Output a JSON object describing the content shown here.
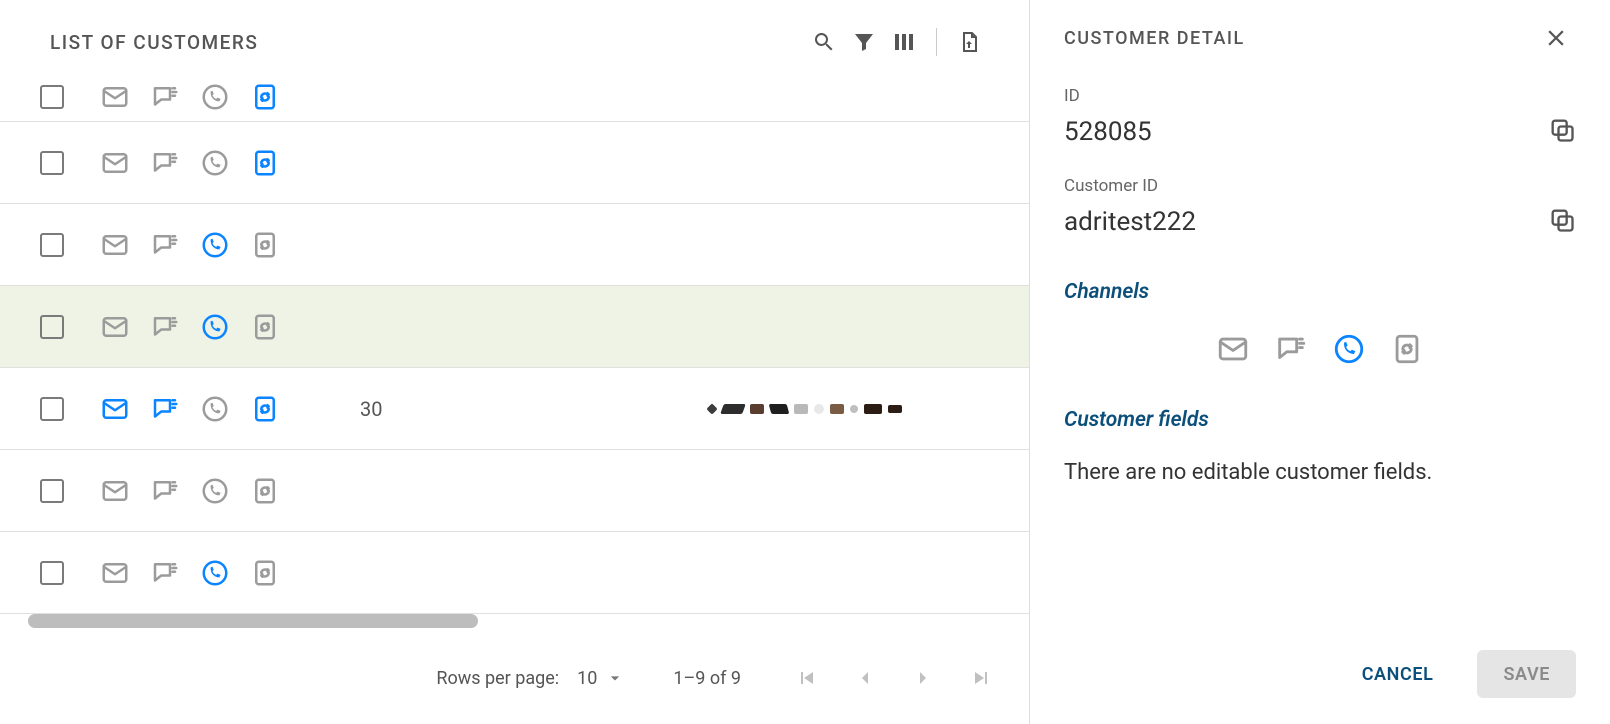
{
  "main": {
    "title": "LIST OF CUSTOMERS",
    "rows": [
      {
        "channels": {
          "mail": false,
          "chat": false,
          "whatsapp": false,
          "sync": true
        },
        "value": "",
        "selected": false
      },
      {
        "channels": {
          "mail": false,
          "chat": false,
          "whatsapp": false,
          "sync": true
        },
        "value": "",
        "selected": false
      },
      {
        "channels": {
          "mail": false,
          "chat": false,
          "whatsapp": true,
          "sync": false
        },
        "value": "",
        "selected": false
      },
      {
        "channels": {
          "mail": false,
          "chat": false,
          "whatsapp": true,
          "sync": false
        },
        "value": "",
        "selected": true
      },
      {
        "channels": {
          "mail": true,
          "chat": true,
          "whatsapp": false,
          "sync": true
        },
        "value": "30",
        "obscured": true,
        "selected": false
      },
      {
        "channels": {
          "mail": false,
          "chat": false,
          "whatsapp": false,
          "sync": false
        },
        "value": "",
        "selected": false
      },
      {
        "channels": {
          "mail": false,
          "chat": false,
          "whatsapp": true,
          "sync": false
        },
        "value": "",
        "selected": false
      }
    ],
    "pager": {
      "rows_label": "Rows per page:",
      "rows_value": "10",
      "range": "1–9 of 9"
    }
  },
  "channel_icons": {
    "mail": "mail-icon",
    "chat": "chat-icon",
    "whatsapp": "whatsapp-icon",
    "sync": "device-sync-icon"
  },
  "detail": {
    "title": "CUSTOMER DETAIL",
    "id_label": "ID",
    "id_value": "528085",
    "customer_id_label": "Customer ID",
    "customer_id_value": "adritest222",
    "channels_title": "Channels",
    "channels": {
      "mail": false,
      "chat": false,
      "whatsapp": true,
      "sync": false
    },
    "fields_title": "Customer fields",
    "no_fields": "There are no editable customer fields.",
    "cancel": "CANCEL",
    "save": "SAVE"
  }
}
